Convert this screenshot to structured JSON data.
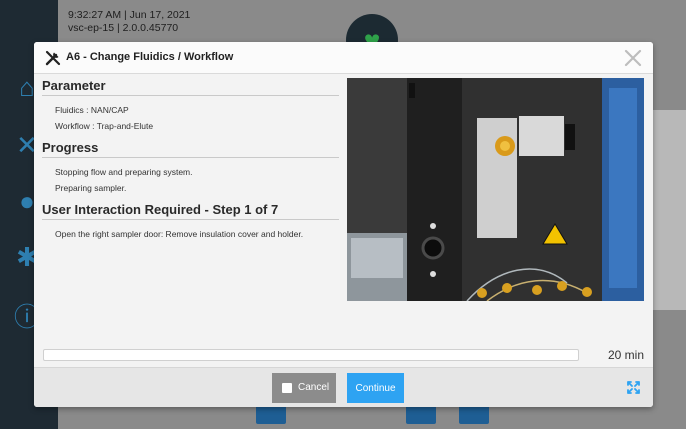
{
  "background": {
    "clock": "9:32:27 AM | Jun 17, 2021",
    "device": "vsc-ep-15 | 2.0.0.45770"
  },
  "dialog": {
    "title": "A6 - Change Fluidics / Workflow",
    "parameter": {
      "heading": "Parameter",
      "lines": [
        "Fluidics : NAN/CAP",
        "Workflow : Trap-and-Elute"
      ]
    },
    "progress": {
      "heading": "Progress",
      "lines": [
        "Stopping flow and preparing system.",
        "Preparing sampler."
      ]
    },
    "interaction": {
      "heading": "User Interaction Required - Step 1 of 7",
      "lines": [
        "Open the right sampler door: Remove insulation cover and holder."
      ]
    },
    "remaining_time": "20 min",
    "progress_fraction": 0.0,
    "cancel_label": "Cancel",
    "continue_label": "Continue"
  },
  "icons": {
    "title": "tools-icon",
    "close": "close-icon",
    "expand": "expand-icon",
    "status": "heart-check-icon",
    "warning": "hazard-warning-icon"
  },
  "colors": {
    "accent": "#2ea3f2",
    "cancel": "#8c8c8c",
    "rail": "#1e2a33",
    "status_ok": "#2fa24a"
  }
}
